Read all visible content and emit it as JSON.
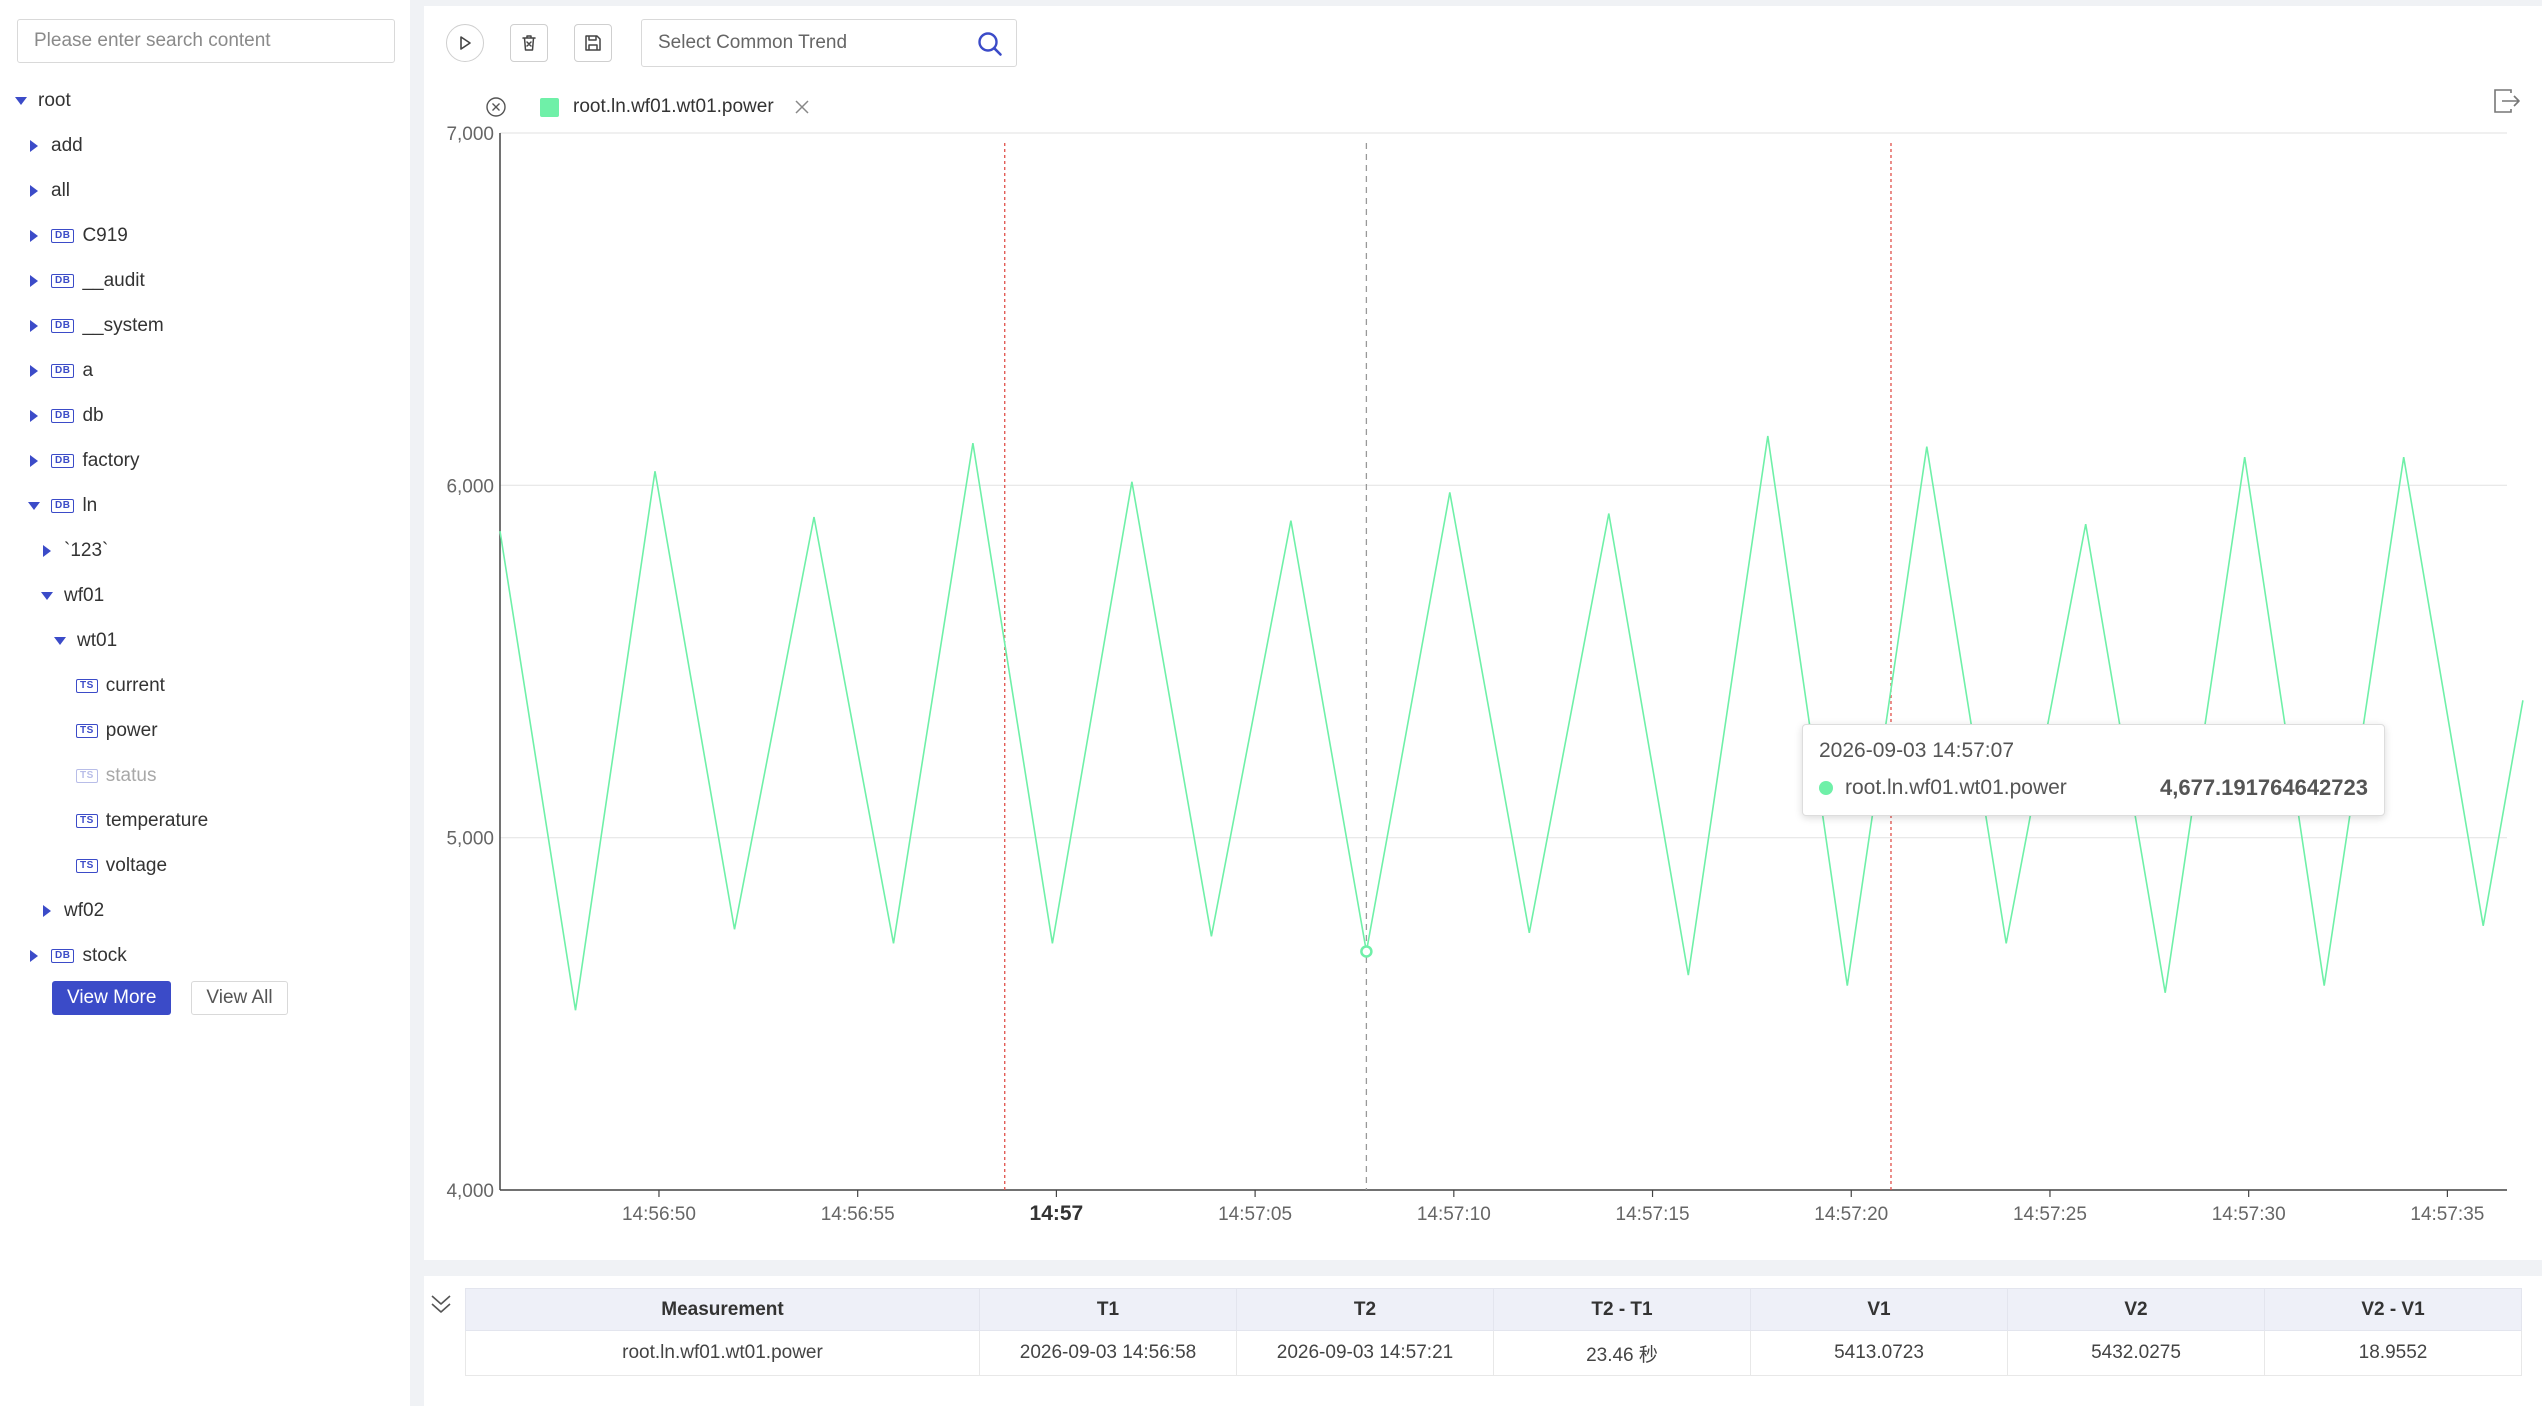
{
  "sidebar": {
    "search_placeholder": "Please enter search content",
    "tree": [
      {
        "label": "root",
        "indent": 0,
        "expanded": true,
        "badge": ""
      },
      {
        "label": "add",
        "indent": 1,
        "expanded": false,
        "badge": ""
      },
      {
        "label": "all",
        "indent": 1,
        "expanded": false,
        "badge": ""
      },
      {
        "label": "C919",
        "indent": 1,
        "expanded": false,
        "badge": "DB"
      },
      {
        "label": "__audit",
        "indent": 1,
        "expanded": false,
        "badge": "DB"
      },
      {
        "label": "__system",
        "indent": 1,
        "expanded": false,
        "badge": "DB"
      },
      {
        "label": "a",
        "indent": 1,
        "expanded": false,
        "badge": "DB"
      },
      {
        "label": "db",
        "indent": 1,
        "expanded": false,
        "badge": "DB"
      },
      {
        "label": "factory",
        "indent": 1,
        "expanded": false,
        "badge": "DB"
      },
      {
        "label": "ln",
        "indent": 1,
        "expanded": true,
        "badge": "DB"
      },
      {
        "label": "`123`",
        "indent": 2,
        "expanded": false,
        "badge": ""
      },
      {
        "label": "wf01",
        "indent": 2,
        "expanded": true,
        "badge": ""
      },
      {
        "label": "wt01",
        "indent": 3,
        "expanded": true,
        "badge": ""
      },
      {
        "label": "current",
        "indent": 4,
        "leaf": true,
        "badge": "TS"
      },
      {
        "label": "power",
        "indent": 4,
        "leaf": true,
        "badge": "TS"
      },
      {
        "label": "status",
        "indent": 4,
        "leaf": true,
        "badge": "TS",
        "muted": true
      },
      {
        "label": "temperature",
        "indent": 4,
        "leaf": true,
        "badge": "TS"
      },
      {
        "label": "voltage",
        "indent": 4,
        "leaf": true,
        "badge": "TS"
      },
      {
        "label": "wf02",
        "indent": 2,
        "expanded": false,
        "badge": ""
      },
      {
        "label": "stock",
        "indent": 1,
        "expanded": false,
        "badge": "DB"
      }
    ],
    "view_more_label": "View More",
    "view_all_label": "View All"
  },
  "toolbar": {
    "run_icon": "play-icon",
    "clear_icon": "delete-icon",
    "save_icon": "save-icon",
    "trend_placeholder": "Select Common Trend",
    "trend_search_icon": "search-icon"
  },
  "legend": {
    "series_name": "root.ln.wf01.wt01.power",
    "color": "#6ff0a8"
  },
  "tooltip": {
    "time": "2026-09-03 14:57:07",
    "series": "root.ln.wf01.wt01.power",
    "value": "4,677.191764642723"
  },
  "chart_data": {
    "type": "line",
    "ylim": [
      4000,
      7000
    ],
    "y_ticks": [
      "4,000",
      "5,000",
      "6,000",
      "7,000"
    ],
    "x_range_seconds": [
      46.0,
      96.5
    ],
    "x_ticks": [
      {
        "t": 50,
        "label": "14:56:50",
        "bold": false
      },
      {
        "t": 55,
        "label": "14:56:55",
        "bold": false
      },
      {
        "t": 60,
        "label": "14:57",
        "bold": true
      },
      {
        "t": 65,
        "label": "14:57:05",
        "bold": false
      },
      {
        "t": 70,
        "label": "14:57:10",
        "bold": false
      },
      {
        "t": 75,
        "label": "14:57:15",
        "bold": false
      },
      {
        "t": 80,
        "label": "14:57:20",
        "bold": false
      },
      {
        "t": 85,
        "label": "14:57:25",
        "bold": false
      },
      {
        "t": 90,
        "label": "14:57:30",
        "bold": false
      },
      {
        "t": 95,
        "label": "14:57:35",
        "bold": false
      }
    ],
    "markers": {
      "t1": 58.7,
      "t2": 81.0,
      "cursor": 67.8
    },
    "series": [
      {
        "name": "root.ln.wf01.wt01.power",
        "color": "#6ff0a8",
        "points": [
          [
            46.0,
            5870
          ],
          [
            47.9,
            4510
          ],
          [
            49.9,
            6040
          ],
          [
            51.9,
            4740
          ],
          [
            53.9,
            5910
          ],
          [
            55.9,
            4700
          ],
          [
            57.9,
            6120
          ],
          [
            59.9,
            4700
          ],
          [
            61.9,
            6010
          ],
          [
            63.9,
            4720
          ],
          [
            65.9,
            5900
          ],
          [
            67.8,
            4677
          ],
          [
            69.9,
            5980
          ],
          [
            71.9,
            4730
          ],
          [
            73.9,
            5920
          ],
          [
            75.9,
            4610
          ],
          [
            77.9,
            6140
          ],
          [
            79.9,
            4580
          ],
          [
            81.9,
            6110
          ],
          [
            83.9,
            4700
          ],
          [
            85.9,
            5890
          ],
          [
            87.9,
            4560
          ],
          [
            89.9,
            6080
          ],
          [
            91.9,
            4580
          ],
          [
            93.9,
            6080
          ],
          [
            95.9,
            4750
          ],
          [
            96.9,
            5390
          ]
        ]
      }
    ]
  },
  "table": {
    "headers": [
      "Measurement",
      "T1",
      "T2",
      "T2 - T1",
      "V1",
      "V2",
      "V2 - V1"
    ],
    "rows": [
      [
        "root.ln.wf01.wt01.power",
        "2026-09-03 14:56:58",
        "2026-09-03 14:57:21",
        "23.46 秒",
        "5413.0723",
        "5432.0275",
        "18.9552"
      ]
    ]
  }
}
